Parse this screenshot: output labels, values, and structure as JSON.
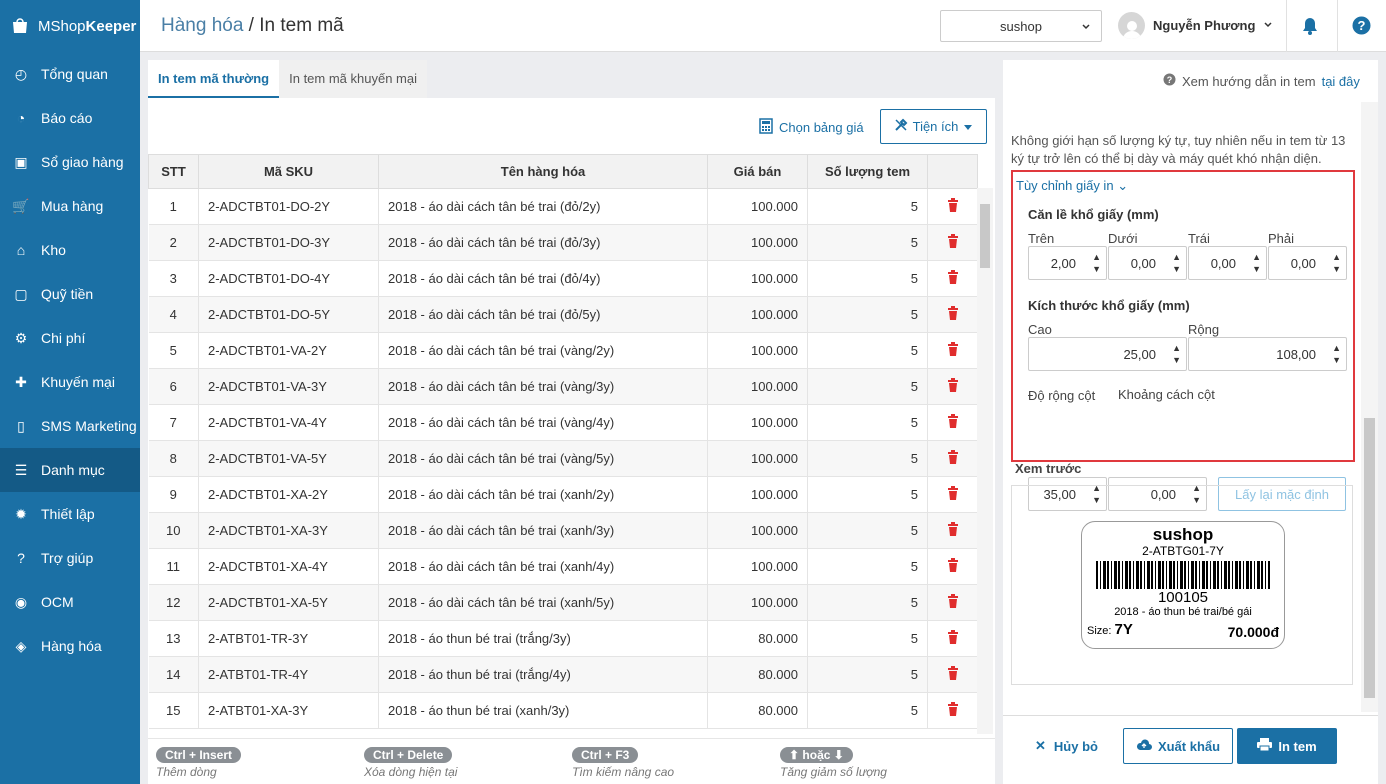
{
  "app": {
    "brand_prefix": "MShop",
    "brand_suffix": "Keeper"
  },
  "sidebar": {
    "items": [
      {
        "label": "Tổng quan",
        "icon": "dashboard-icon"
      },
      {
        "label": "Báo cáo",
        "icon": "pie-chart-icon"
      },
      {
        "label": "Sổ giao hàng",
        "icon": "ledger-icon"
      },
      {
        "label": "Mua hàng",
        "icon": "cart-icon"
      },
      {
        "label": "Kho",
        "icon": "warehouse-icon"
      },
      {
        "label": "Quỹ tiền",
        "icon": "safe-icon"
      },
      {
        "label": "Chi phí",
        "icon": "expense-icon"
      },
      {
        "label": "Khuyến mại",
        "icon": "gift-icon"
      },
      {
        "label": "SMS Marketing",
        "icon": "phone-icon"
      },
      {
        "label": "Danh mục",
        "icon": "list-icon"
      },
      {
        "label": "Thiết lập",
        "icon": "gear-icon"
      },
      {
        "label": "Trợ giúp",
        "icon": "question-icon"
      },
      {
        "label": "OCM",
        "icon": "ocm-icon"
      },
      {
        "label": "Hàng hóa",
        "icon": "boxes-icon"
      }
    ]
  },
  "header": {
    "breadcrumb_parent": "Hàng hóa",
    "breadcrumb_sep": " / ",
    "title": "In tem mã",
    "store": "sushop",
    "user": "Nguyễn Phương"
  },
  "tabs": [
    "In tem mã thường",
    "In tem mã khuyến mại"
  ],
  "toolbar": {
    "price_list": "Chọn bảng giá",
    "utilities": "Tiện ích"
  },
  "table": {
    "columns": [
      "STT",
      "Mã SKU",
      "Tên hàng hóa",
      "Giá bán",
      "Số lượng tem"
    ],
    "rows": [
      [
        "1",
        "2-ADCTBT01-DO-2Y",
        "2018 - áo dài cách tân bé trai (đỏ/2y)",
        "100.000",
        "5"
      ],
      [
        "2",
        "2-ADCTBT01-DO-3Y",
        "2018 - áo dài cách tân bé trai (đỏ/3y)",
        "100.000",
        "5"
      ],
      [
        "3",
        "2-ADCTBT01-DO-4Y",
        "2018 - áo dài cách tân bé trai (đỏ/4y)",
        "100.000",
        "5"
      ],
      [
        "4",
        "2-ADCTBT01-DO-5Y",
        "2018 - áo dài cách tân bé trai (đỏ/5y)",
        "100.000",
        "5"
      ],
      [
        "5",
        "2-ADCTBT01-VA-2Y",
        "2018 - áo dài cách tân bé trai (vàng/2y)",
        "100.000",
        "5"
      ],
      [
        "6",
        "2-ADCTBT01-VA-3Y",
        "2018 - áo dài cách tân bé trai (vàng/3y)",
        "100.000",
        "5"
      ],
      [
        "7",
        "2-ADCTBT01-VA-4Y",
        "2018 - áo dài cách tân bé trai (vàng/4y)",
        "100.000",
        "5"
      ],
      [
        "8",
        "2-ADCTBT01-VA-5Y",
        "2018 - áo dài cách tân bé trai (vàng/5y)",
        "100.000",
        "5"
      ],
      [
        "9",
        "2-ADCTBT01-XA-2Y",
        "2018 - áo dài cách tân bé trai (xanh/2y)",
        "100.000",
        "5"
      ],
      [
        "10",
        "2-ADCTBT01-XA-3Y",
        "2018 - áo dài cách tân bé trai (xanh/3y)",
        "100.000",
        "5"
      ],
      [
        "11",
        "2-ADCTBT01-XA-4Y",
        "2018 - áo dài cách tân bé trai (xanh/4y)",
        "100.000",
        "5"
      ],
      [
        "12",
        "2-ADCTBT01-XA-5Y",
        "2018 - áo dài cách tân bé trai (xanh/5y)",
        "100.000",
        "5"
      ],
      [
        "13",
        "2-ATBT01-TR-3Y",
        "2018 - áo thun bé trai (trắng/3y)",
        "80.000",
        "5"
      ],
      [
        "14",
        "2-ATBT01-TR-4Y",
        "2018 - áo thun bé trai (trắng/4y)",
        "80.000",
        "5"
      ],
      [
        "15",
        "2-ATBT01-XA-3Y",
        "2018 - áo thun bé trai (xanh/3y)",
        "80.000",
        "5"
      ]
    ]
  },
  "shortcuts": [
    {
      "key": "Ctrl + Insert",
      "desc": "Thêm dòng"
    },
    {
      "key": "Ctrl + Delete",
      "desc": "Xóa dòng hiện tại"
    },
    {
      "key": "Ctrl + F3",
      "desc": "Tìm kiếm nâng cao"
    },
    {
      "key": "hoặc",
      "desc": "Tăng giảm số lượng"
    }
  ],
  "right": {
    "guide_text": "Xem hướng dẫn in tem",
    "guide_link": "tại đây",
    "note": "Không giới hạn số lượng ký tự, tuy nhiên nếu in tem từ 13 ký tự trở lên có thể bị dày và máy quét khó nhận diện.",
    "custom_toggle": "Tùy chỉnh giấy in",
    "margins_title": "Căn lề khổ giấy (mm)",
    "margins": [
      {
        "label": "Trên",
        "value": "2,00"
      },
      {
        "label": "Dưới",
        "value": "0,00"
      },
      {
        "label": "Trái",
        "value": "0,00"
      },
      {
        "label": "Phải",
        "value": "0,00"
      }
    ],
    "size_title": "Kích thước khổ giấy (mm)",
    "height_label": "Cao",
    "height_value": "25,00",
    "width_label": "Rộng",
    "width_value": "108,00",
    "col_width_label": "Độ rộng cột",
    "col_width_value": "35,00",
    "col_gap_label": "Khoảng cách cột",
    "col_gap_value": "0,00",
    "reset": "Lấy lại mặc định",
    "preview_title": "Xem trước",
    "preview": {
      "store": "sushop",
      "sku": "2-ATBTG01-7Y",
      "code": "100105",
      "name": "2018 - áo thun bé trai/bé gái",
      "size_label": "Size:",
      "size": "7Y",
      "price": "70.000đ"
    },
    "cancel": "Hủy bỏ",
    "export": "Xuất khẩu",
    "print": "In tem"
  }
}
